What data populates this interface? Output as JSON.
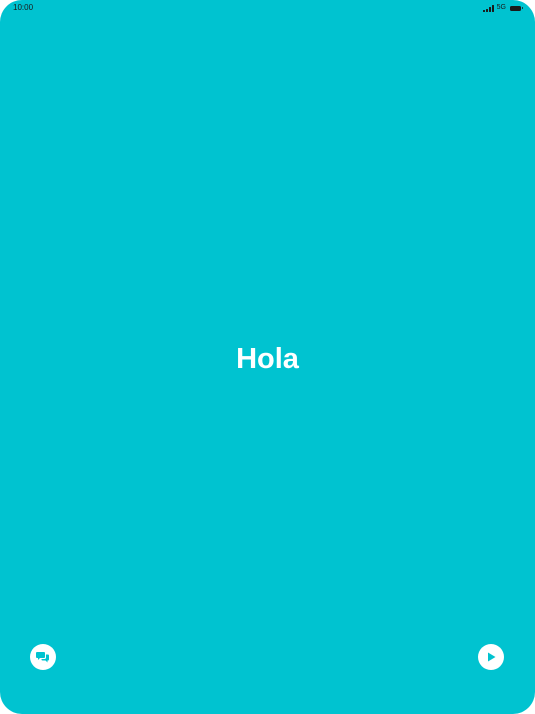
{
  "status_bar": {
    "time": "10:00",
    "network": "5G",
    "icons": [
      "signal-icon",
      "battery-icon"
    ]
  },
  "main": {
    "greeting": "Hola"
  },
  "controls": {
    "left_button_icon": "chat-icon",
    "right_button_icon": "play-icon"
  },
  "colors": {
    "background": "#00c3d0",
    "accent_icon": "#00c3d0",
    "text": "#ffffff"
  }
}
